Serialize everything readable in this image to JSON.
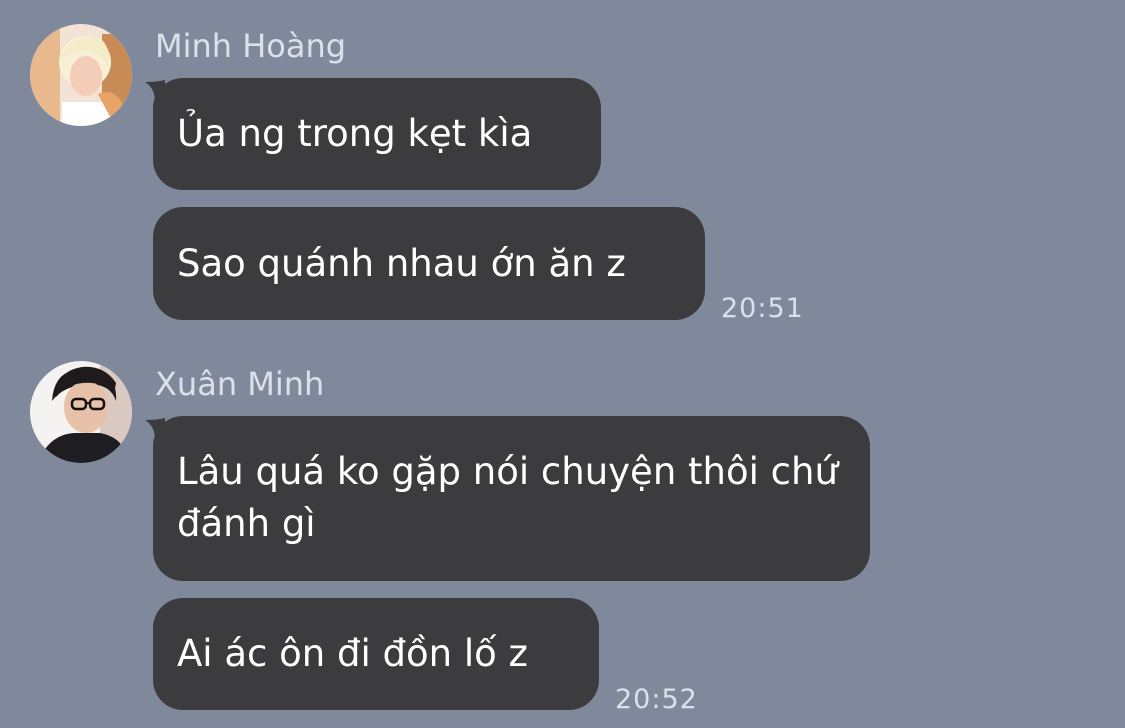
{
  "conversation": {
    "groups": [
      {
        "sender": "Minh Hoàng",
        "messages": [
          "Ủa ng trong kẹt kìa",
          "Sao quánh nhau ớn ăn z"
        ],
        "time": "20:51"
      },
      {
        "sender": "Xuân Minh",
        "messages": [
          "Lâu quá ko gặp nói chuyện thôi chứ đánh gì",
          "Ai ác ôn đi đồn lố z"
        ],
        "time": "20:52"
      }
    ]
  },
  "colors": {
    "background": "#7f899b",
    "bubble": "#3c3c3f",
    "bubble_text": "#ffffff",
    "meta_text": "#dbe0ea"
  }
}
